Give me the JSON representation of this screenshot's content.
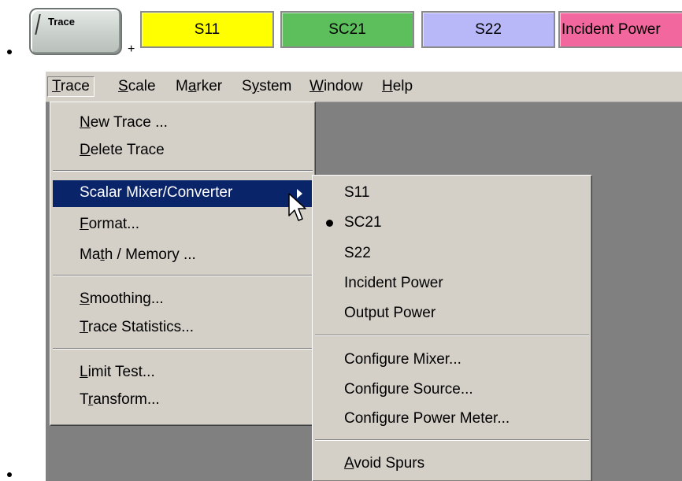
{
  "hardkey": {
    "label": "Trace",
    "suffix": "+"
  },
  "softkeys": [
    {
      "label": "S11",
      "color": "#ffff00"
    },
    {
      "label": "SC21",
      "color": "#5cbf5c"
    },
    {
      "label": "S22",
      "color": "#b8b8f8"
    },
    {
      "label": "Incident Power",
      "color": "#f3679f"
    }
  ],
  "menubar": [
    {
      "pre": "",
      "u": "T",
      "post": "race"
    },
    {
      "pre": "",
      "u": "S",
      "post": "cale"
    },
    {
      "pre": "M",
      "u": "a",
      "post": "rker"
    },
    {
      "pre": "S",
      "u": "y",
      "post": "stem"
    },
    {
      "pre": "",
      "u": "W",
      "post": "indow"
    },
    {
      "pre": "",
      "u": "H",
      "post": "elp"
    }
  ],
  "trace_menu": [
    {
      "pre": "",
      "u": "N",
      "post": "ew Trace ..."
    },
    {
      "pre": "",
      "u": "D",
      "post": "elete Trace"
    },
    {
      "pre": "Scalar Mixer/Converter",
      "u": "",
      "post": ""
    },
    {
      "pre": "",
      "u": "F",
      "post": "ormat..."
    },
    {
      "pre": "Ma",
      "u": "t",
      "post": "h / Memory ..."
    },
    {
      "pre": "",
      "u": "S",
      "post": "moothing..."
    },
    {
      "pre": "",
      "u": "T",
      "post": "race Statistics..."
    },
    {
      "pre": "",
      "u": "L",
      "post": "imit Test..."
    },
    {
      "pre": "T",
      "u": "r",
      "post": "ansform..."
    }
  ],
  "submenu": [
    {
      "pre": "S11",
      "u": "",
      "post": ""
    },
    {
      "pre": "SC21",
      "u": "",
      "post": ""
    },
    {
      "pre": "S22",
      "u": "",
      "post": ""
    },
    {
      "pre": "Incident Power",
      "u": "",
      "post": ""
    },
    {
      "pre": "Output Power",
      "u": "",
      "post": ""
    },
    {
      "pre": "Configure Mixer...",
      "u": "",
      "post": ""
    },
    {
      "pre": "Configure Source...",
      "u": "",
      "post": ""
    },
    {
      "pre": "Configure Power Meter...",
      "u": "",
      "post": ""
    },
    {
      "pre": "",
      "u": "A",
      "post": "void Spurs"
    }
  ],
  "submenu_selected": "SC21"
}
